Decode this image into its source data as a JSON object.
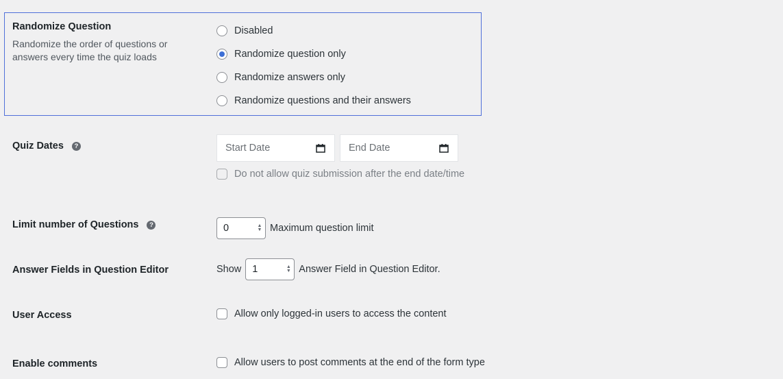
{
  "randomize": {
    "label": "Randomize Question",
    "description": "Randomize the order of questions or answers every time the quiz loads",
    "options": [
      {
        "label": "Disabled",
        "checked": false
      },
      {
        "label": "Randomize question only",
        "checked": true
      },
      {
        "label": "Randomize answers only",
        "checked": false
      },
      {
        "label": "Randomize questions and their answers",
        "checked": false
      }
    ],
    "accent": "#3d6fd6",
    "highlight_border": "#4f6fd9"
  },
  "quiz_dates": {
    "label": "Quiz Dates",
    "help_icon": "question-circle-icon",
    "start_placeholder": "Start Date",
    "end_placeholder": "End Date",
    "calendar_icon": "calendar-icon",
    "checkbox_label": "Do not allow quiz submission after the end date/time",
    "checkbox_checked": false
  },
  "limit_questions": {
    "label": "Limit number of Questions",
    "help_icon": "question-circle-icon",
    "value": "0",
    "suffix": "Maximum question limit"
  },
  "answer_fields": {
    "label": "Answer Fields in Question Editor",
    "prefix": "Show",
    "value": "1",
    "suffix": "Answer Field in Question Editor."
  },
  "user_access": {
    "label": "User Access",
    "checkbox_label": "Allow only logged-in users to access the content",
    "checkbox_checked": false
  },
  "comments": {
    "label": "Enable comments",
    "checkbox_label": "Allow users to post comments at the end of the form type",
    "checkbox_checked": false
  }
}
